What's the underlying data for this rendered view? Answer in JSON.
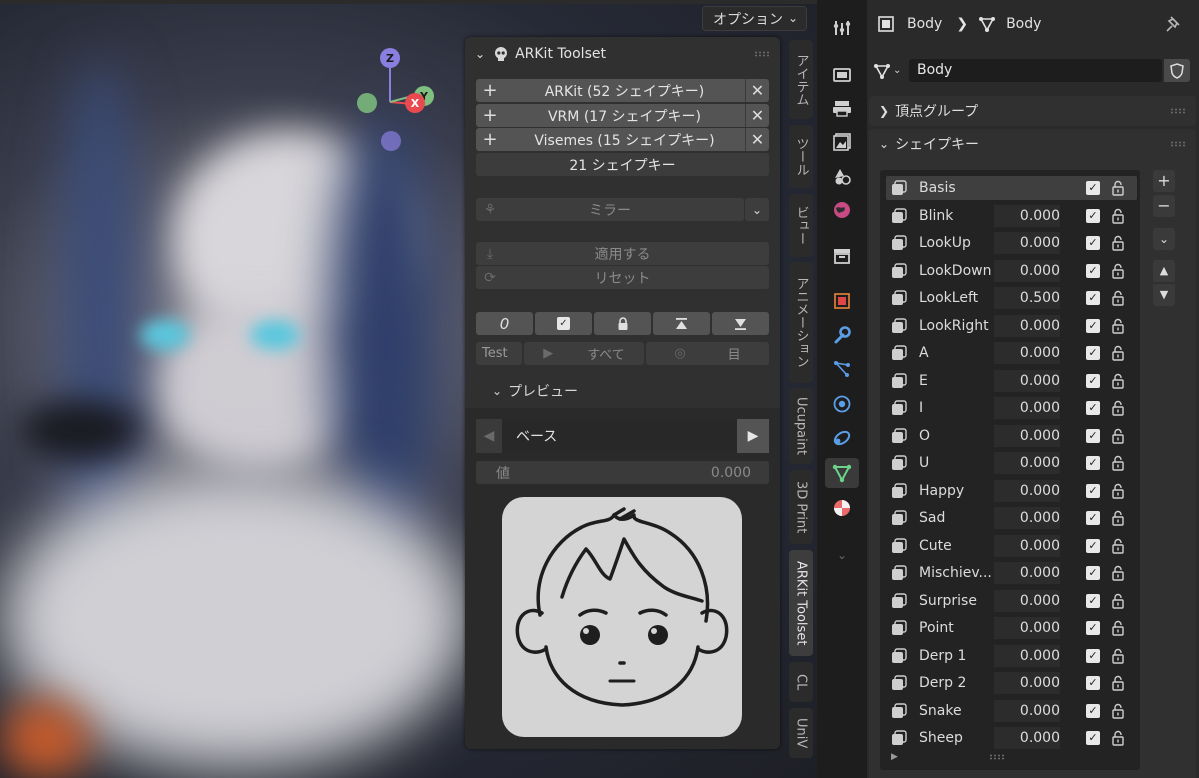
{
  "viewport": {
    "options_label": "オプション",
    "gizmo": {
      "z": "Z",
      "x": "X",
      "y": "Y"
    },
    "side_tabs": [
      "アイテム",
      "ツール",
      "ビュー",
      "アニメーション",
      "Ucupaint",
      "3D Print",
      "ARKit Toolset",
      "CL",
      "UniV"
    ],
    "active_tab": "ARKit Toolset"
  },
  "arkit": {
    "title": "ARKit Toolset",
    "groups": [
      {
        "label": "ARKit (52 シェイプキー)"
      },
      {
        "label": "VRM (17 シェイプキー)"
      },
      {
        "label": "Visemes (15 シェイプキー)"
      }
    ],
    "shapekey_count": "21  シェイプキー",
    "mirror_label": "ミラー",
    "apply_label": "適用する",
    "reset_label": "リセット",
    "tool_icons": [
      "zero-icon",
      "checkbox-icon",
      "lock-icon",
      "move-top-icon",
      "move-bottom-icon"
    ],
    "zero_glyph": "0",
    "test": {
      "label": "Test",
      "all": "すべて",
      "eyes": "目"
    },
    "preview": {
      "label": "プレビュー",
      "selected": "ベース",
      "value_label": "値",
      "value": "0.000"
    }
  },
  "props": {
    "breadcrumb": {
      "object": "Body",
      "mesh": "Body"
    },
    "mesh_name": "Body",
    "vertex_groups_label": "頂点グループ",
    "shape_keys_label": "シェイプキー",
    "shape_keys": [
      {
        "name": "Basis",
        "value": ""
      },
      {
        "name": "Blink",
        "value": "0.000"
      },
      {
        "name": "LookUp",
        "value": "0.000"
      },
      {
        "name": "LookDown",
        "value": "0.000"
      },
      {
        "name": "LookLeft",
        "value": "0.500"
      },
      {
        "name": "LookRight",
        "value": "0.000"
      },
      {
        "name": "A",
        "value": "0.000"
      },
      {
        "name": "E",
        "value": "0.000"
      },
      {
        "name": "I",
        "value": "0.000"
      },
      {
        "name": "O",
        "value": "0.000"
      },
      {
        "name": "U",
        "value": "0.000"
      },
      {
        "name": "Happy",
        "value": "0.000"
      },
      {
        "name": "Sad",
        "value": "0.000"
      },
      {
        "name": "Cute",
        "value": "0.000"
      },
      {
        "name": "Mischiev...",
        "value": "0.000"
      },
      {
        "name": "Surprise",
        "value": "0.000"
      },
      {
        "name": "Point",
        "value": "0.000"
      },
      {
        "name": "Derp 1",
        "value": "0.000"
      },
      {
        "name": "Derp 2",
        "value": "0.000"
      },
      {
        "name": "Snake",
        "value": "0.000"
      },
      {
        "name": "Sheep",
        "value": "0.000"
      }
    ],
    "list_side": {
      "add": "+",
      "remove": "−"
    }
  },
  "colors": {
    "accent_x": "#e84a4f",
    "accent_y": "#7fbf7f",
    "accent_z": "#8a7fe0",
    "active_tab_icon": "#6bd38a"
  }
}
